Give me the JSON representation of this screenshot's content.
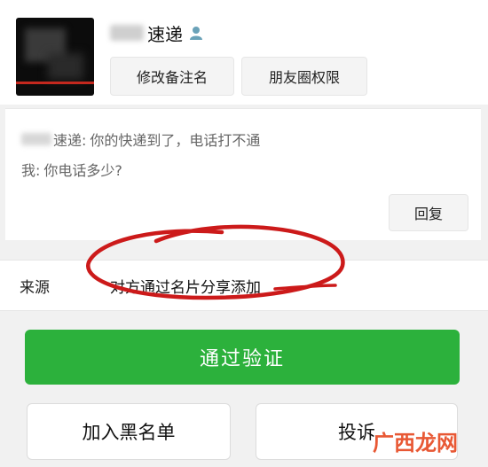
{
  "profile": {
    "display_name": "速递",
    "remark_button": "修改备注名",
    "moments_button": "朋友圈权限"
  },
  "message": {
    "line1_sender": "速递:",
    "line1_text": "你的快递到了，电话打不通",
    "line2_sender": "我:",
    "line2_text": "你电话多少?",
    "reply_button": "回复"
  },
  "source": {
    "label": "来源",
    "value": "对方通过名片分享添加"
  },
  "actions": {
    "approve": "通过验证",
    "blacklist": "加入黑名单",
    "report": "投诉"
  },
  "colors": {
    "approve_green": "#2cb13c",
    "annotation_red": "#cc1a1a",
    "watermark_orange": "#e6461f"
  },
  "watermark": "广西龙网"
}
